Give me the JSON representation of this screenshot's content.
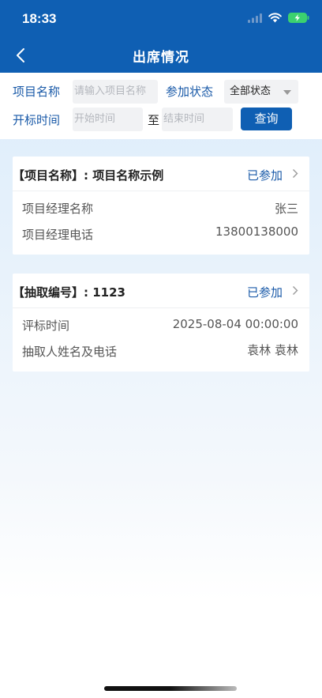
{
  "status_bar": {
    "time": "18:33"
  },
  "nav": {
    "title": "出席情况"
  },
  "filters": {
    "project_name_label": "项目名称",
    "project_name_placeholder": "请输入项目名称",
    "join_status_label": "参加状态",
    "join_status_value": "全部状态",
    "bid_time_label": "开标时间",
    "start_placeholder": "开始时间",
    "range_sep": "至",
    "end_placeholder": "结束时间",
    "query_label": "查询"
  },
  "cards": [
    {
      "title": "【项目名称】: 项目名称示例",
      "status": "已参加",
      "rows": [
        {
          "label": "项目经理名称",
          "value": "张三"
        },
        {
          "label": "项目经理电话",
          "value": "13800138000"
        }
      ]
    },
    {
      "title": "【抽取编号】: 1123",
      "status": "已参加",
      "rows": [
        {
          "label": "评标时间",
          "value": "2025-08-04 00:00:00"
        },
        {
          "label": "抽取人姓名及电话",
          "value": "袁林 袁林"
        }
      ]
    }
  ],
  "colors": {
    "primary": "#0f5fb3",
    "label_blue": "#1a5aa8"
  },
  "icons": [
    "signal-icon",
    "wifi-icon",
    "battery-icon",
    "back-arrow-icon",
    "chevron-right-icon",
    "caret-down-icon"
  ]
}
